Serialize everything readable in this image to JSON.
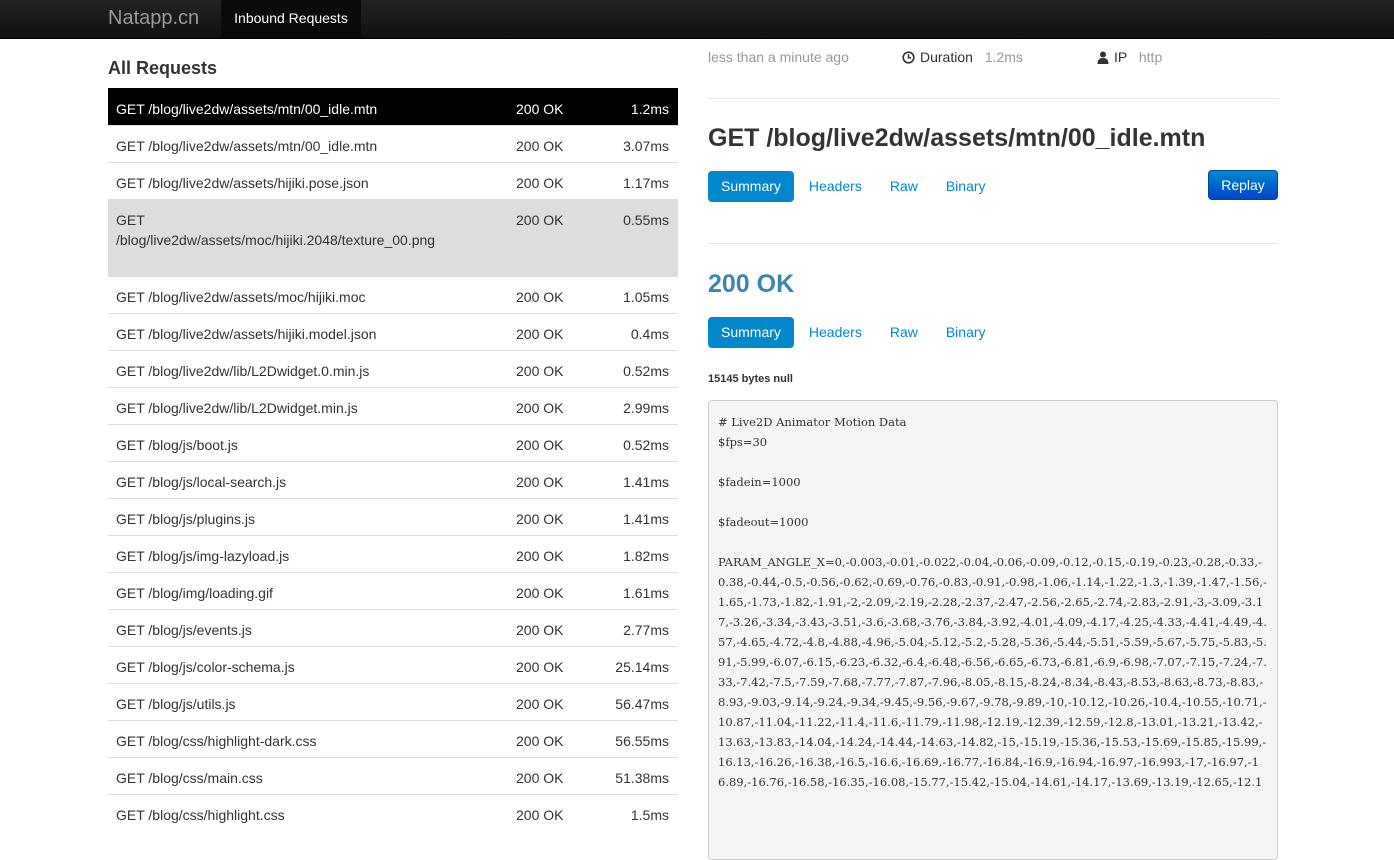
{
  "navbar": {
    "brand": "Natapp.cn",
    "active_tab": "Inbound Requests"
  },
  "requests": {
    "title": "All Requests",
    "rows": [
      {
        "path": "GET /blog/live2dw/assets/mtn/00_idle.mtn",
        "status": "200 OK",
        "duration": "1.2ms"
      },
      {
        "path": "GET /blog/live2dw/assets/mtn/00_idle.mtn",
        "status": "200 OK",
        "duration": "3.07ms"
      },
      {
        "path": "GET /blog/live2dw/assets/hijiki.pose.json",
        "status": "200 OK",
        "duration": "1.17ms"
      },
      {
        "path": "GET /blog/live2dw/assets/moc/hijiki.2048/texture_00.png",
        "status": "200 OK",
        "duration": "0.55ms"
      },
      {
        "path": "GET /blog/live2dw/assets/moc/hijiki.moc",
        "status": "200 OK",
        "duration": "1.05ms"
      },
      {
        "path": "GET /blog/live2dw/assets/hijiki.model.json",
        "status": "200 OK",
        "duration": "0.4ms"
      },
      {
        "path": "GET /blog/live2dw/lib/L2Dwidget.0.min.js",
        "status": "200 OK",
        "duration": "0.52ms"
      },
      {
        "path": "GET /blog/live2dw/lib/L2Dwidget.min.js",
        "status": "200 OK",
        "duration": "2.99ms"
      },
      {
        "path": "GET /blog/js/boot.js",
        "status": "200 OK",
        "duration": "0.52ms"
      },
      {
        "path": "GET /blog/js/local-search.js",
        "status": "200 OK",
        "duration": "1.41ms"
      },
      {
        "path": "GET /blog/js/plugins.js",
        "status": "200 OK",
        "duration": "1.41ms"
      },
      {
        "path": "GET /blog/js/img-lazyload.js",
        "status": "200 OK",
        "duration": "1.82ms"
      },
      {
        "path": "GET /blog/img/loading.gif",
        "status": "200 OK",
        "duration": "1.61ms"
      },
      {
        "path": "GET /blog/js/events.js",
        "status": "200 OK",
        "duration": "2.77ms"
      },
      {
        "path": "GET /blog/js/color-schema.js",
        "status": "200 OK",
        "duration": "25.14ms"
      },
      {
        "path": "GET /blog/js/utils.js",
        "status": "200 OK",
        "duration": "56.47ms"
      },
      {
        "path": "GET /blog/css/highlight-dark.css",
        "status": "200 OK",
        "duration": "56.55ms"
      },
      {
        "path": "GET /blog/css/main.css",
        "status": "200 OK",
        "duration": "51.38ms"
      },
      {
        "path": "GET /blog/css/highlight.css",
        "status": "200 OK",
        "duration": "1.5ms"
      }
    ]
  },
  "detail": {
    "time_ago": "less than a minute ago",
    "duration_label": "Duration",
    "duration_value": "1.2ms",
    "ip_label": "IP",
    "ip_value": "http",
    "request_title": "GET /blog/live2dw/assets/mtn/00_idle.mtn",
    "tabs": [
      "Summary",
      "Headers",
      "Raw",
      "Binary"
    ],
    "replay_label": "Replay",
    "response_status": "200 OK",
    "bytes_info": "15145 bytes null",
    "body": "# Live2D Animator Motion Data\n$fps=30\n\n$fadein=1000\n\n$fadeout=1000\n\nPARAM_ANGLE_X=0,-0.003,-0.01,-0.022,-0.04,-0.06,-0.09,-0.12,-0.15,-0.19,-0.23,-0.28,-0.33,-0.38,-0.44,-0.5,-0.56,-0.62,-0.69,-0.76,-0.83,-0.91,-0.98,-1.06,-1.14,-1.22,-1.3,-1.39,-1.47,-1.56,-1.65,-1.73,-1.82,-1.91,-2,-2.09,-2.19,-2.28,-2.37,-2.47,-2.56,-2.65,-2.74,-2.83,-2.91,-3,-3.09,-3.17,-3.26,-3.34,-3.43,-3.51,-3.6,-3.68,-3.76,-3.84,-3.92,-4.01,-4.09,-4.17,-4.25,-4.33,-4.41,-4.49,-4.57,-4.65,-4.72,-4.8,-4.88,-4.96,-5.04,-5.12,-5.2,-5.28,-5.36,-5.44,-5.51,-5.59,-5.67,-5.75,-5.83,-5.91,-5.99,-6.07,-6.15,-6.23,-6.32,-6.4,-6.48,-6.56,-6.65,-6.73,-6.81,-6.9,-6.98,-7.07,-7.15,-7.24,-7.33,-7.42,-7.5,-7.59,-7.68,-7.77,-7.87,-7.96,-8.05,-8.15,-8.24,-8.34,-8.43,-8.53,-8.63,-8.73,-8.83,-8.93,-9.03,-9.14,-9.24,-9.34,-9.45,-9.56,-9.67,-9.78,-9.89,-10,-10.12,-10.26,-10.4,-10.55,-10.71,-10.87,-11.04,-11.22,-11.4,-11.6,-11.79,-11.98,-12.19,-12.39,-12.59,-12.8,-13.01,-13.21,-13.42,-13.63,-13.83,-14.04,-14.24,-14.44,-14.63,-14.82,-15,-15.19,-15.36,-15.53,-15.69,-15.85,-15.99,-16.13,-16.26,-16.38,-16.5,-16.6,-16.69,-16.77,-16.84,-16.9,-16.94,-16.97,-16.993,-17,-16.97,-16.89,-16.76,-16.58,-16.35,-16.08,-15.77,-15.42,-15.04,-14.61,-14.17,-13.69,-13.19,-12.65,-12.1"
  }
}
